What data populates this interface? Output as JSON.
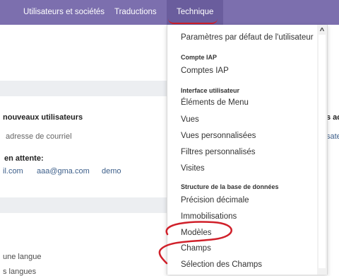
{
  "topnav": {
    "items": [
      "Utilisateurs et sociétés",
      "Traductions",
      "Technique"
    ]
  },
  "background": {
    "section_title": "nouveaux utilisateurs",
    "email_hint": "adresse de courriel",
    "pending_label": "en attente:",
    "pending_items": [
      "il.com",
      "aaa@gma.com",
      "demo"
    ],
    "lang_1": "une langue",
    "lang_2": "s langues",
    "right_title": "s ac",
    "right_link": "sateu"
  },
  "dropdown": {
    "default_settings": "Paramètres par défaut de l'utilisateur",
    "iap_header": "Compte IAP",
    "iap_accounts": "Comptes IAP",
    "ui_header": "Interface utilisateur",
    "menu_items": "Éléments de Menu",
    "views": "Vues",
    "custom_views": "Vues personnalisées",
    "custom_filters": "Filtres personnalisés",
    "tours": "Visites",
    "db_header": "Structure de la base de données",
    "decimal_precision": "Précision décimale",
    "assets": "Immobilisations",
    "models": "Modèles",
    "fields": "Champs",
    "field_selection": "Sélection des Champs"
  },
  "colors": {
    "navbar": "#7c6fae",
    "annotation": "#d0202a"
  }
}
